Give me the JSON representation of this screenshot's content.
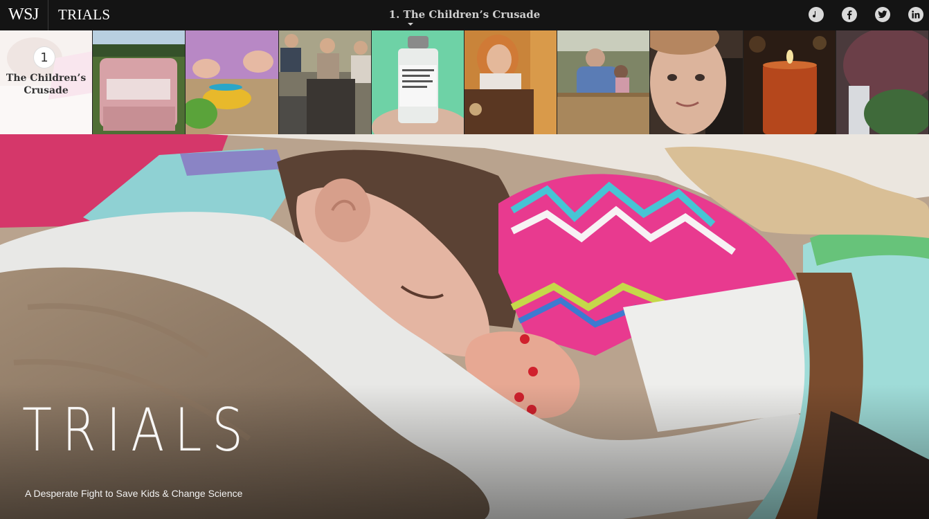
{
  "header": {
    "logo": "WSJ",
    "title": "TRIALS",
    "chapter_selector": "1. The Children’s Crusade",
    "icons": [
      {
        "name": "music-note-icon",
        "glyph": "♪"
      },
      {
        "name": "facebook-icon",
        "glyph": "f"
      },
      {
        "name": "twitter-icon",
        "glyph": "t"
      },
      {
        "name": "linkedin-icon",
        "glyph": "in"
      }
    ]
  },
  "filmstrip": {
    "active_number": "1",
    "active_label": "The Children’s Crusade",
    "thumbs": [
      {
        "scene": "sleeping-child",
        "colors": [
          "#c9a7a0",
          "#e8d8d0"
        ]
      },
      {
        "scene": "pink-armchair",
        "colors": [
          "#5b7a3d",
          "#d9a6a8"
        ]
      },
      {
        "scene": "pills-in-bowls",
        "colors": [
          "#b59a70",
          "#e0b23a"
        ]
      },
      {
        "scene": "family-on-patio",
        "colors": [
          "#6f6a5c",
          "#3a3a3a"
        ]
      },
      {
        "scene": "medicine-vial",
        "colors": [
          "#6fd0a8",
          "#e7e7e7"
        ]
      },
      {
        "scene": "speaker-at-podium",
        "colors": [
          "#c67f34",
          "#4a2c18"
        ]
      },
      {
        "scene": "father-and-child-bench",
        "colors": [
          "#8b8f6e",
          "#4d6fa0"
        ]
      },
      {
        "scene": "boy-portrait",
        "colors": [
          "#d8b19a",
          "#3a2e26"
        ]
      },
      {
        "scene": "lit-candle",
        "colors": [
          "#2a1b14",
          "#b54a1c"
        ]
      },
      {
        "scene": "tree-and-house",
        "colors": [
          "#5c3a3f",
          "#3f5a3a"
        ]
      }
    ]
  },
  "hero": {
    "title": "TRIALS",
    "subtitle": "A Desperate Fight to Save Kids & Change Science"
  }
}
